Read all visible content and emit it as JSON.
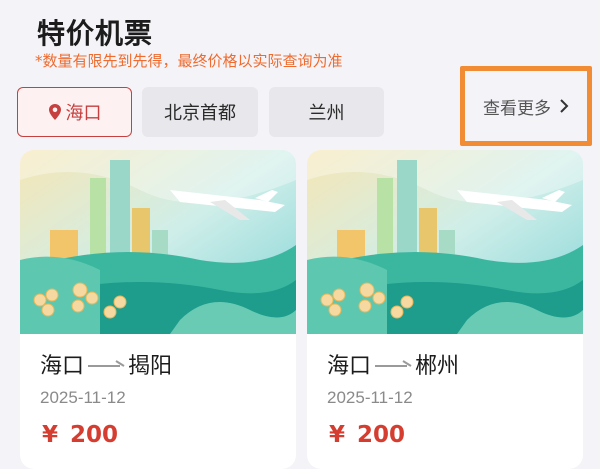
{
  "header": {
    "title": "特价机票",
    "subtitle": "*数量有限先到先得，最终价格以实际查询为准"
  },
  "city_tabs": [
    {
      "label": "海口",
      "icon": "location-pin-icon",
      "active": true
    },
    {
      "label": "北京首都",
      "active": false
    },
    {
      "label": "兰州",
      "active": false
    }
  ],
  "more_link": {
    "label": "查看更多",
    "icon": "chevron-right-icon"
  },
  "colors": {
    "accent": "#c6403f",
    "price": "#d43d2f",
    "notice": "#ef6b2e",
    "highlight": "#f28c34"
  },
  "flights": [
    {
      "from": "海口",
      "to": "揭阳",
      "date": "2025-11-12",
      "currency": "¥",
      "price": "200"
    },
    {
      "from": "海口",
      "to": "郴州",
      "date": "2025-11-12",
      "currency": "¥",
      "price": "200"
    }
  ]
}
